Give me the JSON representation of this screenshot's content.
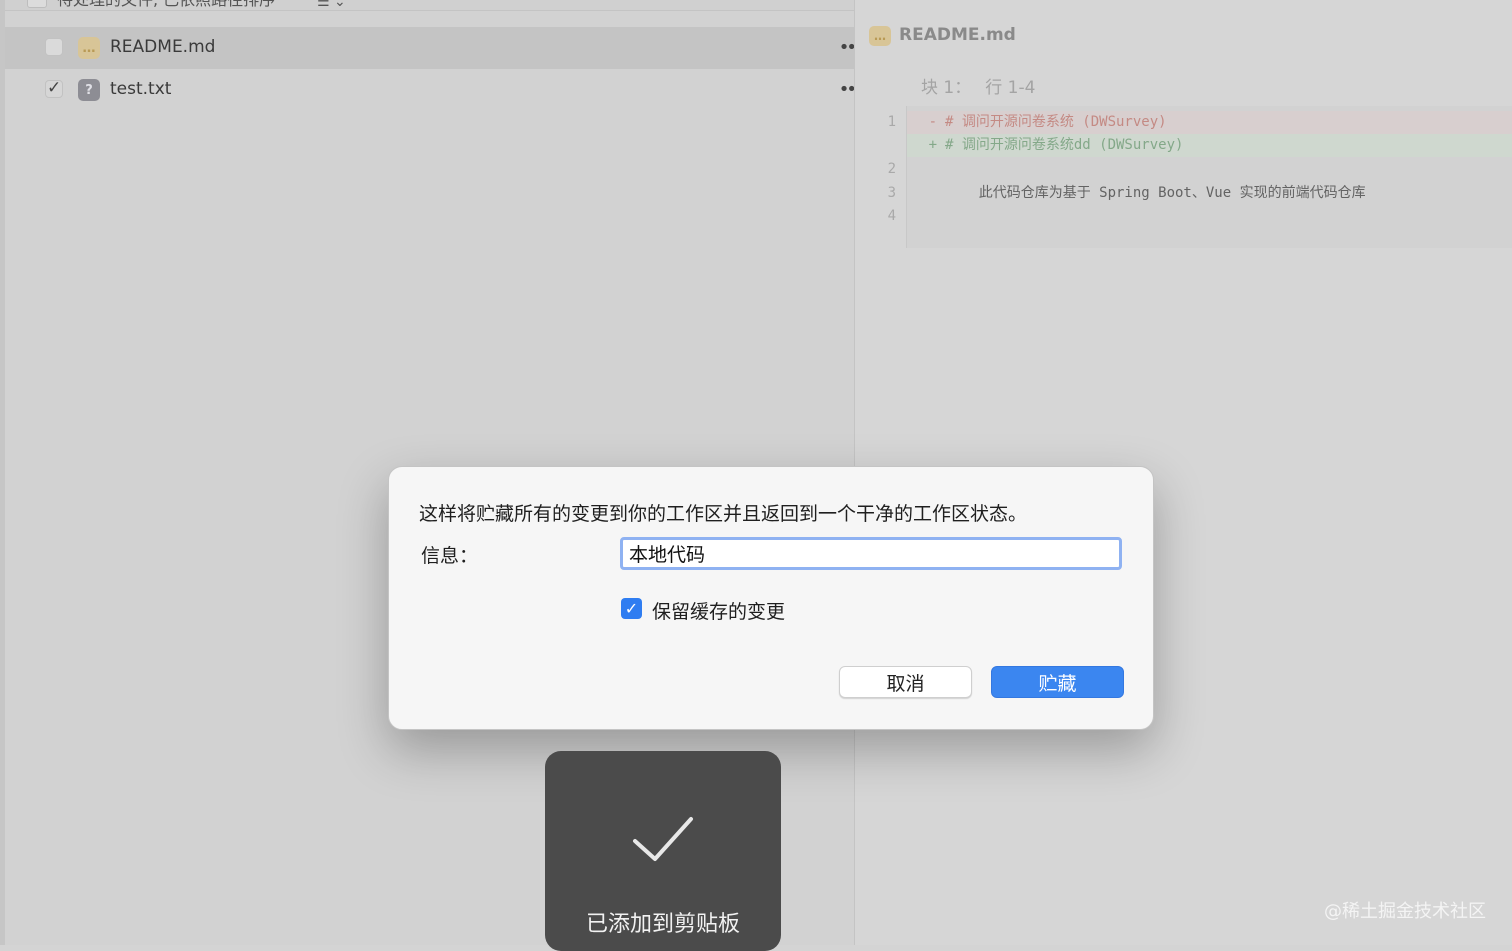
{
  "file_list": {
    "header_text": "待处理的文件, 已依照路径排序",
    "header_menu": "☰ ⌄",
    "files": [
      {
        "name": "README.md",
        "status_icon": "…",
        "checked": false
      },
      {
        "name": "test.txt",
        "status_icon": "?",
        "checked": true
      }
    ],
    "row_menu": "••"
  },
  "diff": {
    "file_icon": "…",
    "file_title": "README.md",
    "hunk_label": "块 1：",
    "hunk_range": "行 1-4",
    "line_numbers": [
      "1",
      "2",
      "3",
      "4"
    ],
    "lines": [
      {
        "type": "del",
        "mark": "-",
        "text": "# 调问开源问卷系统 (DWSurvey)"
      },
      {
        "type": "add",
        "mark": "+",
        "text": "# 调问开源问卷系统dd (DWSurvey)"
      },
      {
        "type": "ctx",
        "mark": "",
        "text": ""
      },
      {
        "type": "ctx",
        "mark": "",
        "text": "    此代码仓库为基于 Spring Boot、Vue 实现的前端代码仓库"
      },
      {
        "type": "ctx",
        "mark": "",
        "text": ""
      }
    ]
  },
  "stash_dialog": {
    "message": "这样将贮藏所有的变更到你的工作区并且返回到一个干净的工作区状态。",
    "info_label": "信息：",
    "info_value": "本地代码",
    "keep_staged_label": "保留缓存的变更",
    "keep_staged_checked": true,
    "cancel_label": "取消",
    "confirm_label": "贮藏"
  },
  "hud": {
    "icon": "checkmark-icon",
    "text": "已添加到剪贴板"
  },
  "watermark": "@稀土掘金技术社区",
  "colors": {
    "primary_button": "#3b86f0",
    "checkbox_accent": "#2f7df1",
    "deleted_line": "#c48a84",
    "added_line": "#84a889"
  }
}
